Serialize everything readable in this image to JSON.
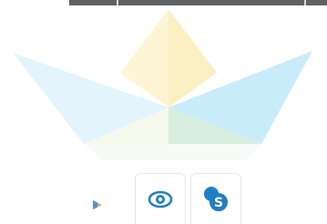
{
  "colors": {
    "boat_blue": "#cdeefc",
    "boat_yellow": "#fdf3cc",
    "boat_green": "#d9f0dc",
    "icon_blue": "#1e7fc7"
  },
  "logo": {
    "icon": "paper-boat-logo"
  },
  "toolbar": {
    "items": [
      {
        "icon": "play-indicator-icon"
      },
      {
        "icon": "eye-icon"
      },
      {
        "icon": "skype-icon"
      }
    ]
  }
}
